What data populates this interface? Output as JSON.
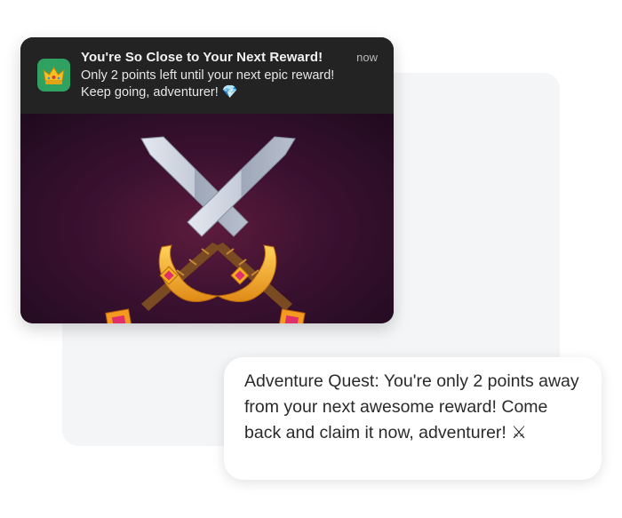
{
  "notification": {
    "app_icon": "crown-icon",
    "title": "You're So Close to Your Next Reward!",
    "time": "now",
    "body": "Only 2 points left until your next epic reward! Keep going, adventurer!",
    "emoji": "💎",
    "image": "crossed-swords-illustration"
  },
  "message": {
    "text": "Adventure Quest: You're only 2 points away from your next awesome reward! Come back and claim it now, adventurer!",
    "emoji": "⚔"
  },
  "colors": {
    "app_icon_bg": "#2fa160",
    "notification_bg": "#232323",
    "image_bg": "#3b1130",
    "background_card": "#f4f5f7"
  }
}
